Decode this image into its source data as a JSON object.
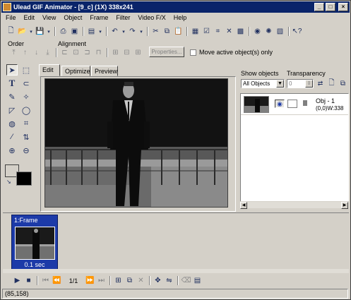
{
  "window": {
    "title": "Ulead GIF Animator - [9_c] (1X) 338x241",
    "minimize_icon": "minimize-icon",
    "maximize_icon": "maximize-icon",
    "close_icon": "close-icon"
  },
  "menu": [
    "File",
    "Edit",
    "View",
    "Object",
    "Frame",
    "Filter",
    "Video F/X",
    "Help"
  ],
  "order_label": "Order",
  "alignment_label": "Alignment",
  "properties_label": "Properties...",
  "move_active_label": "Move active object(s) only",
  "tabs": [
    "Edit",
    "Optimize",
    "Preview"
  ],
  "show_objects_label": "Show objects",
  "show_objects_value": "All Objects",
  "transparency_label": "Transparency",
  "transparency_value": "0",
  "object": {
    "name": "Obj - 1",
    "info": "(0,0)W:338"
  },
  "frame": {
    "title": "1:Frame",
    "delay": "0.1 sec"
  },
  "frame_counter": "1/1",
  "status": "(85,158)",
  "colors": {
    "titlebar": "#0a246a",
    "frame_selected": "#1c3aa8",
    "background": "#d4d0c8"
  }
}
